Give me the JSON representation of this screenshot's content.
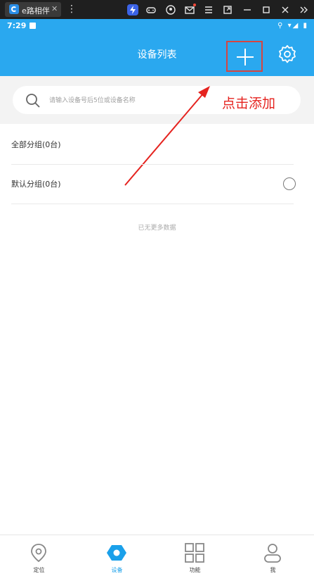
{
  "titlebar": {
    "tab_title": "e路相伴",
    "tab_close": "✕",
    "kebab": "⋮",
    "icons": [
      "bolt-icon",
      "gamepad-icon",
      "account-icon",
      "mail-icon",
      "menu-icon",
      "external-icon",
      "minimize-icon",
      "maximize-icon",
      "close-icon",
      "collapse-icon"
    ]
  },
  "statusbar": {
    "time": "7:29",
    "right": "⚲ ▾◢ ▮"
  },
  "header": {
    "title": "设备列表"
  },
  "search": {
    "placeholder": "请输入设备号后5位或设备名称"
  },
  "annotation": {
    "text": "点击添加",
    "color": "#e5231f"
  },
  "groups": [
    {
      "label": "全部分组(0台)"
    },
    {
      "label": "默认分组(0台)"
    }
  ],
  "list_footer": "已无更多数据",
  "nav": [
    {
      "label": "定位",
      "icon": "location-icon"
    },
    {
      "label": "设备",
      "icon": "device-icon",
      "active": true
    },
    {
      "label": "功能",
      "icon": "grid-icon"
    },
    {
      "label": "我",
      "icon": "user-icon"
    }
  ],
  "colors": {
    "primary": "#2aa8ef",
    "active": "#1aa0ea",
    "highlight_box": "#d64541"
  }
}
